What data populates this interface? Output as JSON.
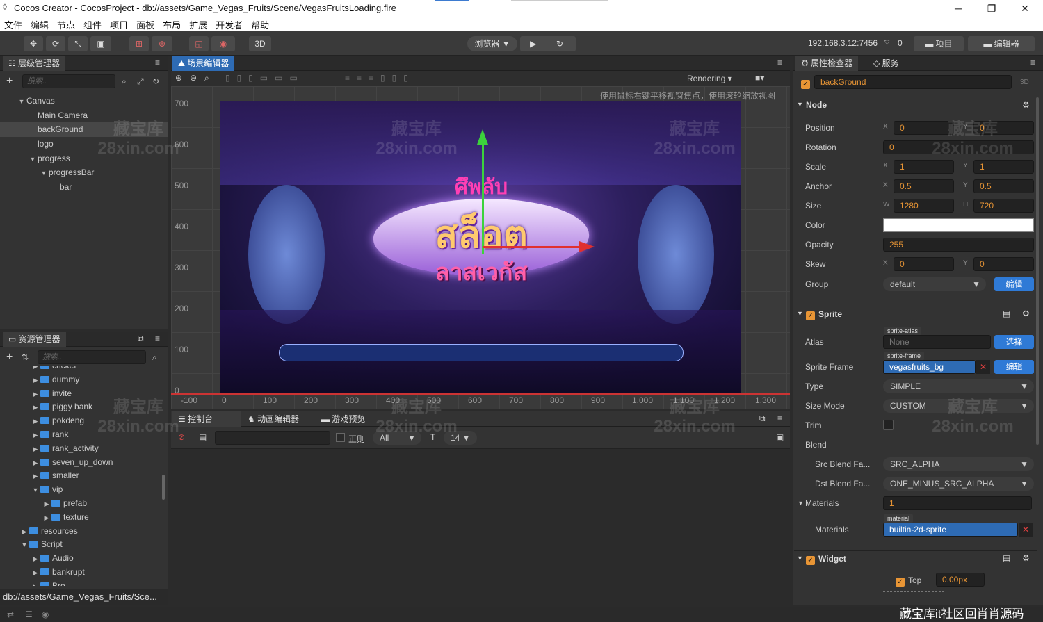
{
  "window": {
    "title": "Cocos Creator - CocosProject - db://assets/Game_Vegas_Fruits/Scene/VegasFruitsLoading.fire"
  },
  "menu": [
    "文件",
    "编辑",
    "节点",
    "组件",
    "项目",
    "面板",
    "布局",
    "扩展",
    "开发者",
    "帮助"
  ],
  "toolbar": {
    "mode3d": "3D",
    "browser": "浏览器 ▼",
    "ip": "192.168.3.12:7456",
    "conn_count": "0",
    "project_btn": "项目",
    "editor_btn": "编辑器"
  },
  "hierarchy": {
    "title": "层级管理器",
    "search_placeholder": "搜索..",
    "nodes": [
      {
        "label": "Canvas",
        "depth": 0,
        "expand": "▼"
      },
      {
        "label": "Main Camera",
        "depth": 1,
        "expand": ""
      },
      {
        "label": "backGround",
        "depth": 1,
        "expand": ""
      },
      {
        "label": "logo",
        "depth": 1,
        "expand": ""
      },
      {
        "label": "progress",
        "depth": 1,
        "expand": "▼"
      },
      {
        "label": "progressBar",
        "depth": 2,
        "expand": "▼"
      },
      {
        "label": "bar",
        "depth": 3,
        "expand": ""
      }
    ]
  },
  "assets": {
    "title": "资源管理器",
    "search_placeholder": "搜索..",
    "items": [
      {
        "label": "cricket",
        "depth": 1,
        "expand": "▶"
      },
      {
        "label": "dummy",
        "depth": 1,
        "expand": "▶"
      },
      {
        "label": "invite",
        "depth": 1,
        "expand": "▶"
      },
      {
        "label": "piggy bank",
        "depth": 1,
        "expand": "▶"
      },
      {
        "label": "pokdeng",
        "depth": 1,
        "expand": "▶"
      },
      {
        "label": "rank",
        "depth": 1,
        "expand": "▶"
      },
      {
        "label": "rank_activity",
        "depth": 1,
        "expand": "▶"
      },
      {
        "label": "seven_up_down",
        "depth": 1,
        "expand": "▶"
      },
      {
        "label": "smaller",
        "depth": 1,
        "expand": "▶"
      },
      {
        "label": "vip",
        "depth": 1,
        "expand": "▼"
      },
      {
        "label": "prefab",
        "depth": 2,
        "expand": "▶"
      },
      {
        "label": "texture",
        "depth": 2,
        "expand": "▶"
      },
      {
        "label": "resources",
        "depth": 0,
        "expand": "▶"
      },
      {
        "label": "Script",
        "depth": 0,
        "expand": "▼"
      },
      {
        "label": "Audio",
        "depth": 1,
        "expand": "▶"
      },
      {
        "label": "bankrupt",
        "depth": 1,
        "expand": "▶"
      },
      {
        "label": "Bro...",
        "depth": 1,
        "expand": "▶"
      }
    ],
    "path": "db://assets/Game_Vegas_Fruits/Sce..."
  },
  "scene": {
    "tab": "场景编辑器",
    "rendering": "Rendering",
    "hint": "使用鼠标右键平移视窗焦点，使用滚轮缩放视图",
    "y_ticks": [
      "700",
      "600",
      "500",
      "400",
      "300",
      "200",
      "100",
      "0"
    ],
    "x_ticks": [
      "-100",
      "0",
      "100",
      "200",
      "300",
      "400",
      "500",
      "600",
      "700",
      "800",
      "900",
      "1,000",
      "1,100",
      "1,200",
      "1,300"
    ],
    "logo_top": "ศึพลับ",
    "logo_mid": "สล็อต",
    "logo_bot": "ลาสเวกัส"
  },
  "console": {
    "tabs": [
      "控制台",
      "动画编辑器",
      "游戏预览"
    ],
    "regex": "正则",
    "level": "All",
    "font_size": "14 ▼"
  },
  "inspector": {
    "tabs": [
      "属性检查器",
      "服务"
    ],
    "node_name": "backGround",
    "badge3d": "3D",
    "node_section": "Node",
    "position": {
      "label": "Position",
      "x": "0",
      "y": "0"
    },
    "rotation": {
      "label": "Rotation",
      "value": "0"
    },
    "scale": {
      "label": "Scale",
      "x": "1",
      "y": "1"
    },
    "anchor": {
      "label": "Anchor",
      "x": "0.5",
      "y": "0.5"
    },
    "size": {
      "label": "Size",
      "w": "1280",
      "h": "720"
    },
    "color": {
      "label": "Color",
      "value": "#ffffff"
    },
    "opacity": {
      "label": "Opacity",
      "value": "255"
    },
    "skew": {
      "label": "Skew",
      "x": "0",
      "y": "0"
    },
    "group": {
      "label": "Group",
      "value": "default",
      "btn": "编辑"
    },
    "sprite_section": "Sprite",
    "atlas": {
      "label": "Atlas",
      "tag": "sprite-atlas",
      "value": "None",
      "btn": "选择"
    },
    "sprite_frame": {
      "label": "Sprite Frame",
      "tag": "sprite-frame",
      "value": "vegasfruits_bg",
      "btn": "编辑"
    },
    "type": {
      "label": "Type",
      "value": "SIMPLE"
    },
    "size_mode": {
      "label": "Size Mode",
      "value": "CUSTOM"
    },
    "trim": {
      "label": "Trim"
    },
    "blend": {
      "label": "Blend"
    },
    "src_blend": {
      "label": "Src Blend Fa...",
      "value": "SRC_ALPHA"
    },
    "dst_blend": {
      "label": "Dst Blend Fa...",
      "value": "ONE_MINUS_SRC_ALPHA"
    },
    "materials_count": {
      "label": "Materials",
      "value": "1"
    },
    "materials": {
      "label": "Materials",
      "tag": "material",
      "value": "builtin-2d-sprite"
    },
    "widget_section": "Widget",
    "widget_top": {
      "label": "Top",
      "value": "0.00px"
    }
  },
  "watermarks": {
    "cn": "藏宝库",
    "en": "28xin.com",
    "footer": "藏宝库it社区回肖肖源码"
  },
  "colors": {
    "accent": "#e89535",
    "select_blue": "#2e6bb4",
    "button_blue": "#2f7ad6"
  }
}
